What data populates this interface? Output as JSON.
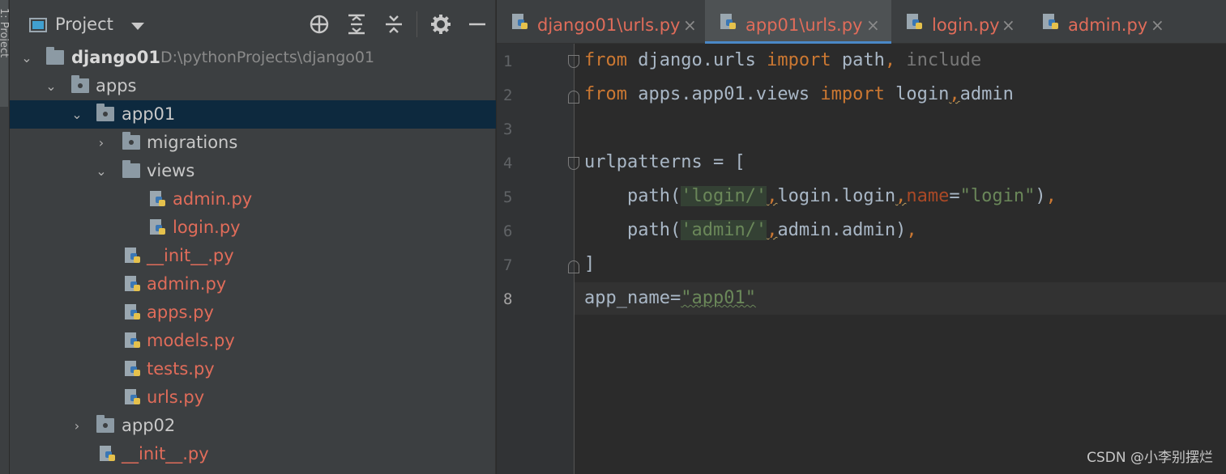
{
  "sidebar_stripe": {
    "label": "1: Project"
  },
  "project_panel": {
    "title": "Project",
    "tools": [
      "locate-icon",
      "expand-all-icon",
      "collapse-all-icon",
      "gear-icon",
      "minimize-icon"
    ],
    "tree": [
      {
        "label": "django01",
        "path": "D:\\pythonProjects\\django01"
      },
      {
        "label": "apps"
      },
      {
        "label": "app01"
      },
      {
        "label": "migrations"
      },
      {
        "label": "views"
      },
      {
        "label": "admin.py"
      },
      {
        "label": "login.py"
      },
      {
        "label": "__init__.py"
      },
      {
        "label": "admin.py"
      },
      {
        "label": "apps.py"
      },
      {
        "label": "models.py"
      },
      {
        "label": "tests.py"
      },
      {
        "label": "urls.py"
      },
      {
        "label": "app02"
      },
      {
        "label": "__init__.py"
      }
    ]
  },
  "editor": {
    "tabs": [
      {
        "label": "django01\\urls.py",
        "active": false
      },
      {
        "label": "app01\\urls.py",
        "active": true
      },
      {
        "label": "login.py",
        "active": false
      },
      {
        "label": "admin.py",
        "active": false
      }
    ],
    "close_glyph": "×",
    "line_numbers": [
      "1",
      "2",
      "3",
      "4",
      "5",
      "6",
      "7",
      "8"
    ],
    "current_line": "8",
    "code": {
      "l1": {
        "kw1": "from",
        "t1": " django.urls ",
        "kw2": "import",
        "t2": " path",
        "c": ",",
        "inactive": " include"
      },
      "l2": {
        "kw1": "from",
        "t1": " apps.app01.views ",
        "kw2": "import",
        "t2": " login",
        "c": ",",
        "t3": "admin"
      },
      "l4": {
        "t1": "urlpatterns = ["
      },
      "l5": {
        "t1": "    path(",
        "s1": "'login/'",
        "c1": ",",
        "t2": "login.login",
        "c2": ",",
        "p": "name",
        "eq": "=",
        "s2": "\"login\"",
        "t3": ")",
        "c3": ","
      },
      "l6": {
        "t1": "    path(",
        "s1": "'admin/'",
        "c1": ",",
        "t2": "admin.admin)",
        "c2": ","
      },
      "l7": {
        "t1": "]"
      },
      "l8": {
        "t1": "app_name=",
        "s1": "\"app01\""
      }
    }
  },
  "watermark": "CSDN @小李别摆烂"
}
